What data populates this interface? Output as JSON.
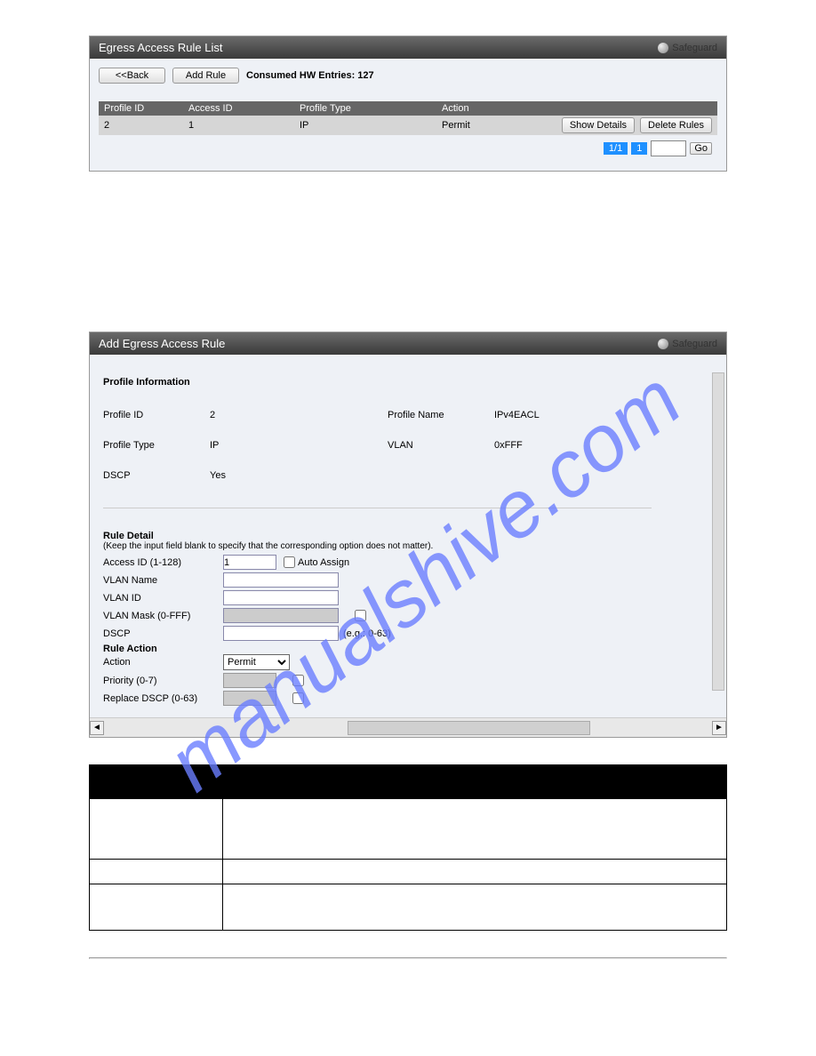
{
  "panel1": {
    "title": "Egress Access Rule List",
    "safeguard": "Safeguard",
    "back_btn": "<<Back",
    "add_btn": "Add Rule",
    "consumed": "Consumed HW Entries: 127",
    "headers": {
      "c1": "Profile ID",
      "c2": "Access ID",
      "c3": "Profile Type",
      "c4": "Action"
    },
    "row": {
      "c1": "2",
      "c2": "1",
      "c3": "IP",
      "c4": "Permit",
      "show": "Show Details",
      "del": "Delete Rules"
    },
    "pager": {
      "total": "1/1",
      "current": "1",
      "go": "Go"
    }
  },
  "panel2": {
    "title": "Add Egress Access Rule",
    "safeguard": "Safeguard",
    "profile_info": "Profile Information",
    "pid_label": "Profile ID",
    "pid_val": "2",
    "pname_label": "Profile Name",
    "pname_val": "IPv4EACL",
    "ptype_label": "Profile Type",
    "ptype_val": "IP",
    "vlan_label": "VLAN",
    "vlan_val": "0xFFF",
    "dscp_label": "DSCP",
    "dscp_val": "Yes",
    "rule_detail": "Rule Detail",
    "rule_hint": "(Keep the input field blank to specify that the corresponding option does not matter).",
    "access_id_label": "Access ID (1-128)",
    "access_id_val": "1",
    "auto_assign": "Auto Assign",
    "vlan_name_label": "VLAN Name",
    "vlan_id_label": "VLAN ID",
    "vlan_mask_label": "VLAN Mask (0-FFF)",
    "dscp_field_label": "DSCP",
    "dscp_hint": "(e.g.: 0-63)",
    "rule_action": "Rule Action",
    "action_label": "Action",
    "action_val": "Permit",
    "priority_label": "Priority (0-7)",
    "replace_dscp_label": "Replace DSCP (0-63)"
  }
}
